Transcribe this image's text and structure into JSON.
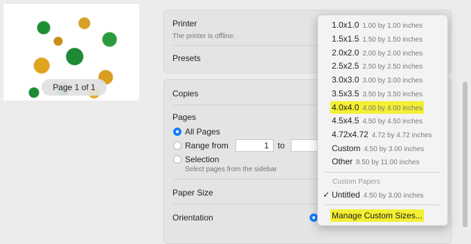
{
  "preview": {
    "page_indicator": "Page 1 of 1"
  },
  "printer": {
    "label": "Printer",
    "status": "The printer is offline."
  },
  "presets": {
    "label": "Presets"
  },
  "copies": {
    "label": "Copies"
  },
  "pages": {
    "label": "Pages",
    "all_label": "All Pages",
    "range_label": "Range from",
    "range_from": "1",
    "range_to_label": "to",
    "selection_label": "Selection",
    "selection_hint": "Select pages from the sidebar",
    "selected": "All Pages"
  },
  "paper_size": {
    "label": "Paper Size"
  },
  "orientation": {
    "label": "Orientation"
  },
  "paper_menu": {
    "items": [
      {
        "name": "1.0x1.0",
        "dims": "1.00 by 1.00 inches"
      },
      {
        "name": "1.5x1.5",
        "dims": "1.50 by 1.50 inches"
      },
      {
        "name": "2.0x2.0",
        "dims": "2.00 by 2.00 inches"
      },
      {
        "name": "2.5x2.5",
        "dims": "2.50 by 2.50 inches"
      },
      {
        "name": "3.0x3.0",
        "dims": "3.00 by 3.00 inches"
      },
      {
        "name": "3.5x3.5",
        "dims": "3.50 by 3.50 inches"
      },
      {
        "name": "4.0x4.0",
        "dims": "4.00 by 4.00 inches",
        "highlighted": true
      },
      {
        "name": "4.5x4.5",
        "dims": "4.50 by 4.50 inches"
      },
      {
        "name": "4.72x4.72",
        "dims": "4.72 by 4.72 inches"
      },
      {
        "name": "Custom",
        "dims": "4.50 by 3.00 inches"
      },
      {
        "name": "Other",
        "dims": "8.50 by 11.00 inches"
      }
    ],
    "custom_section_label": "Custom Papers",
    "custom_items": [
      {
        "name": "Untitled",
        "dims": "4.50 by 3.00 inches",
        "checked": true
      }
    ],
    "manage_label": "Manage Custom Sizes...",
    "highlight_color": "#f3ef33"
  },
  "colors": {
    "accent": "#1a7cff",
    "panel": "#e4e4e4",
    "window": "#ececec"
  }
}
